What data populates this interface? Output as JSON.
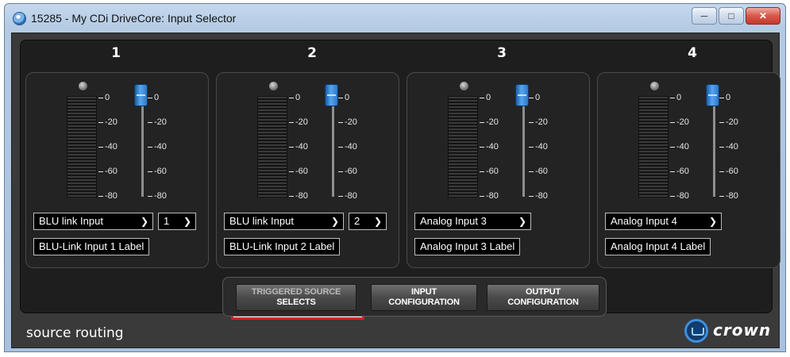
{
  "window": {
    "title": "15285 - My CDi DriveCore: Input Selector",
    "minimize_icon": "minimize-icon",
    "maximize_icon": "maximize-icon",
    "close_icon": "close-icon"
  },
  "scale": {
    "meter_marks": [
      "0",
      "-20",
      "-40",
      "-60",
      "-80"
    ],
    "fader_marks": [
      "0",
      "-20",
      "-40",
      "-60",
      "-80"
    ]
  },
  "channels": [
    {
      "number": "1",
      "source": "BLU link Input",
      "link_number": "1",
      "label": "BLU-Link Input 1 Label"
    },
    {
      "number": "2",
      "source": "BLU link Input",
      "link_number": "2",
      "label": "BLU-Link Input 2 Label"
    },
    {
      "number": "3",
      "source": "Analog Input 3",
      "link_number": null,
      "label": "Analog Input 3 Label"
    },
    {
      "number": "4",
      "source": "Analog Input 4",
      "link_number": null,
      "label": "Analog Input 4 Label"
    }
  ],
  "buttons": {
    "triggered_line1": "TRIGGERED SOURCE",
    "triggered_line2": "SELECTS",
    "input_line1": "INPUT",
    "input_line2": "CONFIGURATION",
    "output_line1": "OUTPUT",
    "output_line2": "CONFIGURATION"
  },
  "footer": {
    "section_title": "source routing",
    "brand": "crown"
  },
  "colors": {
    "fader_blue": "#3a8ae0",
    "highlight_red": "#d8232a",
    "panel_bg": "#232323"
  }
}
